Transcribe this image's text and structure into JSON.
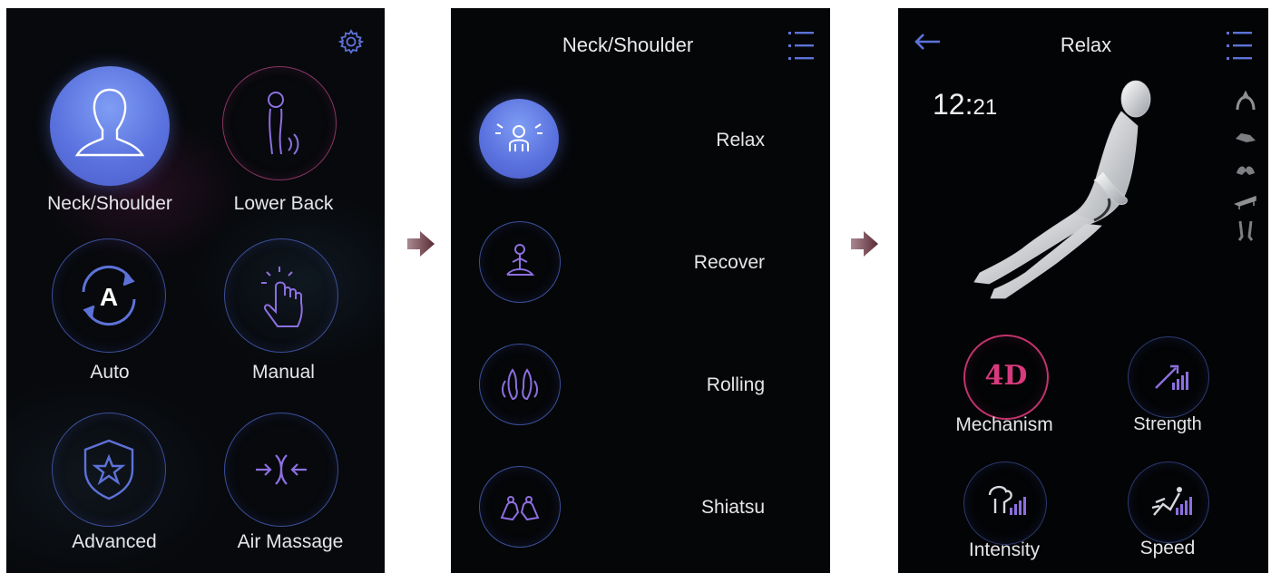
{
  "screen_main": {
    "tiles": [
      {
        "label": "Neck/Shoulder",
        "icon": "person-bust-icon"
      },
      {
        "label": "Lower Back",
        "icon": "lower-back-icon"
      },
      {
        "label": "Auto",
        "icon": "auto-mode-icon",
        "glyph": "A"
      },
      {
        "label": "Manual",
        "icon": "hand-press-icon"
      },
      {
        "label": "Advanced",
        "icon": "shield-star-icon"
      },
      {
        "label": "Air Massage",
        "icon": "air-compress-icon"
      }
    ],
    "settings_icon": "gear-icon"
  },
  "screen_programs": {
    "title": "Neck/Shoulder",
    "menu_icon": "list-icon",
    "items": [
      {
        "label": "Relax",
        "icon": "relax-person-icon"
      },
      {
        "label": "Recover",
        "icon": "meditation-icon"
      },
      {
        "label": "Rolling",
        "icon": "rolling-hands-icon"
      },
      {
        "label": "Shiatsu",
        "icon": "shiatsu-hands-icon"
      }
    ]
  },
  "screen_session": {
    "title": "Relax",
    "back_icon": "back-arrow-icon",
    "menu_icon": "list-icon",
    "timer_minutes": "12",
    "timer_separator": ":",
    "timer_seconds": "21",
    "body_zone_icons": [
      "shoulders-icon",
      "back-icon",
      "waist-icon",
      "seat-icon",
      "legs-icon"
    ],
    "controls": [
      {
        "label": "Mechanism",
        "glyph": "4D",
        "icon": "4d-icon"
      },
      {
        "label": "Strength",
        "icon": "strength-icon"
      },
      {
        "label": "Intensity",
        "icon": "intensity-icon"
      },
      {
        "label": "Speed",
        "icon": "speed-icon"
      }
    ]
  },
  "flow_arrows": [
    "next-arrow-icon",
    "next-arrow-icon"
  ],
  "colors": {
    "accent_blue": "#5b73df",
    "ring_blue": "#3b4f9a",
    "ring_pink": "#8a3466",
    "background": "#050608"
  }
}
